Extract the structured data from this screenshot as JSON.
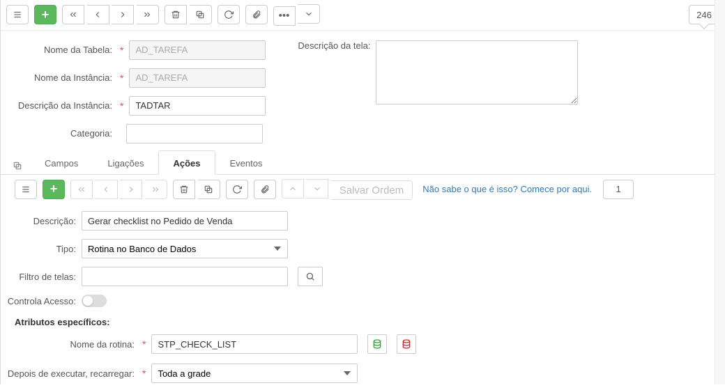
{
  "top": {
    "counter": "246"
  },
  "form": {
    "nome_tabela_label": "Nome da Tabela:",
    "nome_tabela": "AD_TAREFA",
    "nome_inst_label": "Nome da Instância:",
    "nome_inst": "AD_TAREFA",
    "desc_inst_label": "Descrição da Instância:",
    "desc_inst": "TADTAR",
    "categoria_label": "Categoria:",
    "categoria": "",
    "desc_tela_label": "Descrição da tela:",
    "desc_tela": ""
  },
  "tabs": {
    "t0": "Campos",
    "t1": "Ligações",
    "t2": "Ações",
    "t3": "Eventos"
  },
  "sub": {
    "salvar_ordem": "Salvar Ordem",
    "help_link": "Não sabe o que é isso? Comece por aqui.",
    "counter": "1",
    "descricao_label": "Descrição:",
    "descricao": "Gerar checklist no Pedido de Venda",
    "tipo_label": "Tipo:",
    "tipo": "Rotina no Banco de Dados",
    "filtro_label": "Filtro de telas:",
    "filtro": "",
    "controla_label": "Controla Acesso:",
    "section_title": "Atributos específicos:",
    "nome_rotina_label": "Nome da rotina:",
    "nome_rotina": "STP_CHECK_LIST",
    "depois_label": "Depois de executar, recarregar:",
    "depois": "Toda a grade"
  }
}
